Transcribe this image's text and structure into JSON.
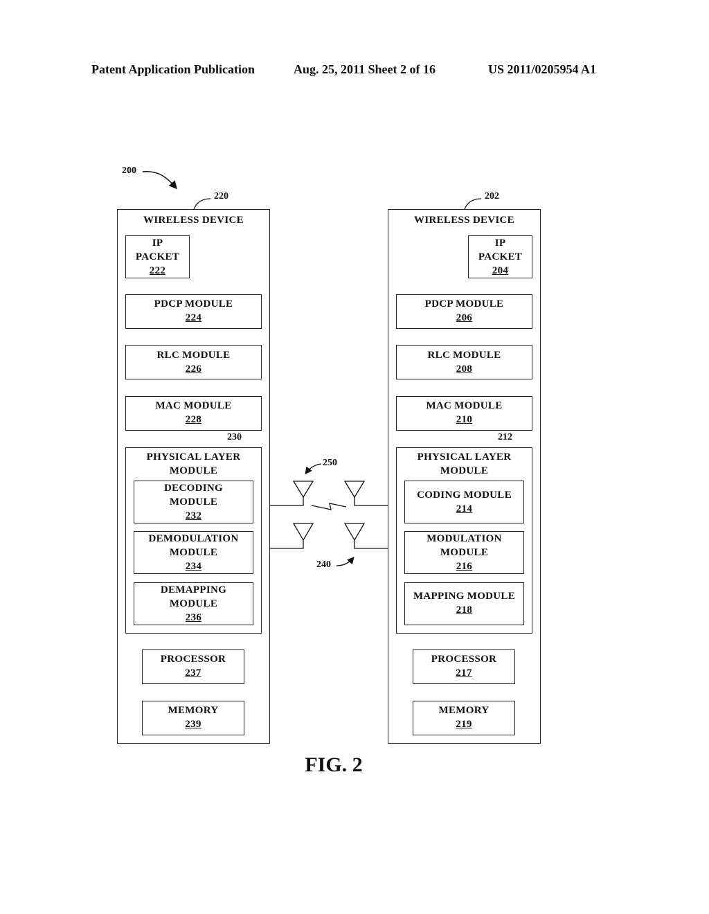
{
  "header": {
    "publication": "Patent Application Publication",
    "date_sheet": "Aug. 25, 2011  Sheet 2 of 16",
    "number": "US 2011/0205954 A1"
  },
  "figure": {
    "ref": "200",
    "caption": "FIG. 2",
    "link_ref_upper": "250",
    "link_ref_lower": "240"
  },
  "left_device": {
    "ref": "220",
    "title": "WIRELESS DEVICE",
    "ip_packet": {
      "line1": "IP",
      "line2": "PACKET",
      "ref": "222"
    },
    "pdcp": {
      "label": "PDCP MODULE",
      "ref": "224"
    },
    "rlc": {
      "label": "RLC MODULE",
      "ref": "226"
    },
    "mac": {
      "label": "MAC MODULE",
      "ref": "228"
    },
    "phy": {
      "line1": "PHYSICAL LAYER",
      "line2": "MODULE",
      "ref": "230"
    },
    "sub1": {
      "line1": "DECODING",
      "line2": "MODULE",
      "ref": "232"
    },
    "sub2": {
      "line1": "DEMODULATION",
      "line2": "MODULE",
      "ref": "234"
    },
    "sub3": {
      "line1": "DEMAPPING",
      "line2": "MODULE",
      "ref": "236"
    },
    "processor": {
      "label": "PROCESSOR",
      "ref": "237"
    },
    "memory": {
      "label": "MEMORY",
      "ref": "239"
    }
  },
  "right_device": {
    "ref": "202",
    "title": "WIRELESS DEVICE",
    "ip_packet": {
      "line1": "IP",
      "line2": "PACKET",
      "ref": "204"
    },
    "pdcp": {
      "label": "PDCP MODULE",
      "ref": "206"
    },
    "rlc": {
      "label": "RLC MODULE",
      "ref": "208"
    },
    "mac": {
      "label": "MAC MODULE",
      "ref": "210"
    },
    "phy": {
      "line1": "PHYSICAL LAYER",
      "line2": "MODULE",
      "ref": "212"
    },
    "sub1": {
      "line1": "CODING MODULE",
      "ref": "214"
    },
    "sub2": {
      "line1": "MODULATION",
      "line2": "MODULE",
      "ref": "216"
    },
    "sub3": {
      "line1": "MAPPING MODULE",
      "ref": "218"
    },
    "processor": {
      "label": "PROCESSOR",
      "ref": "217"
    },
    "memory": {
      "label": "MEMORY",
      "ref": "219"
    }
  }
}
